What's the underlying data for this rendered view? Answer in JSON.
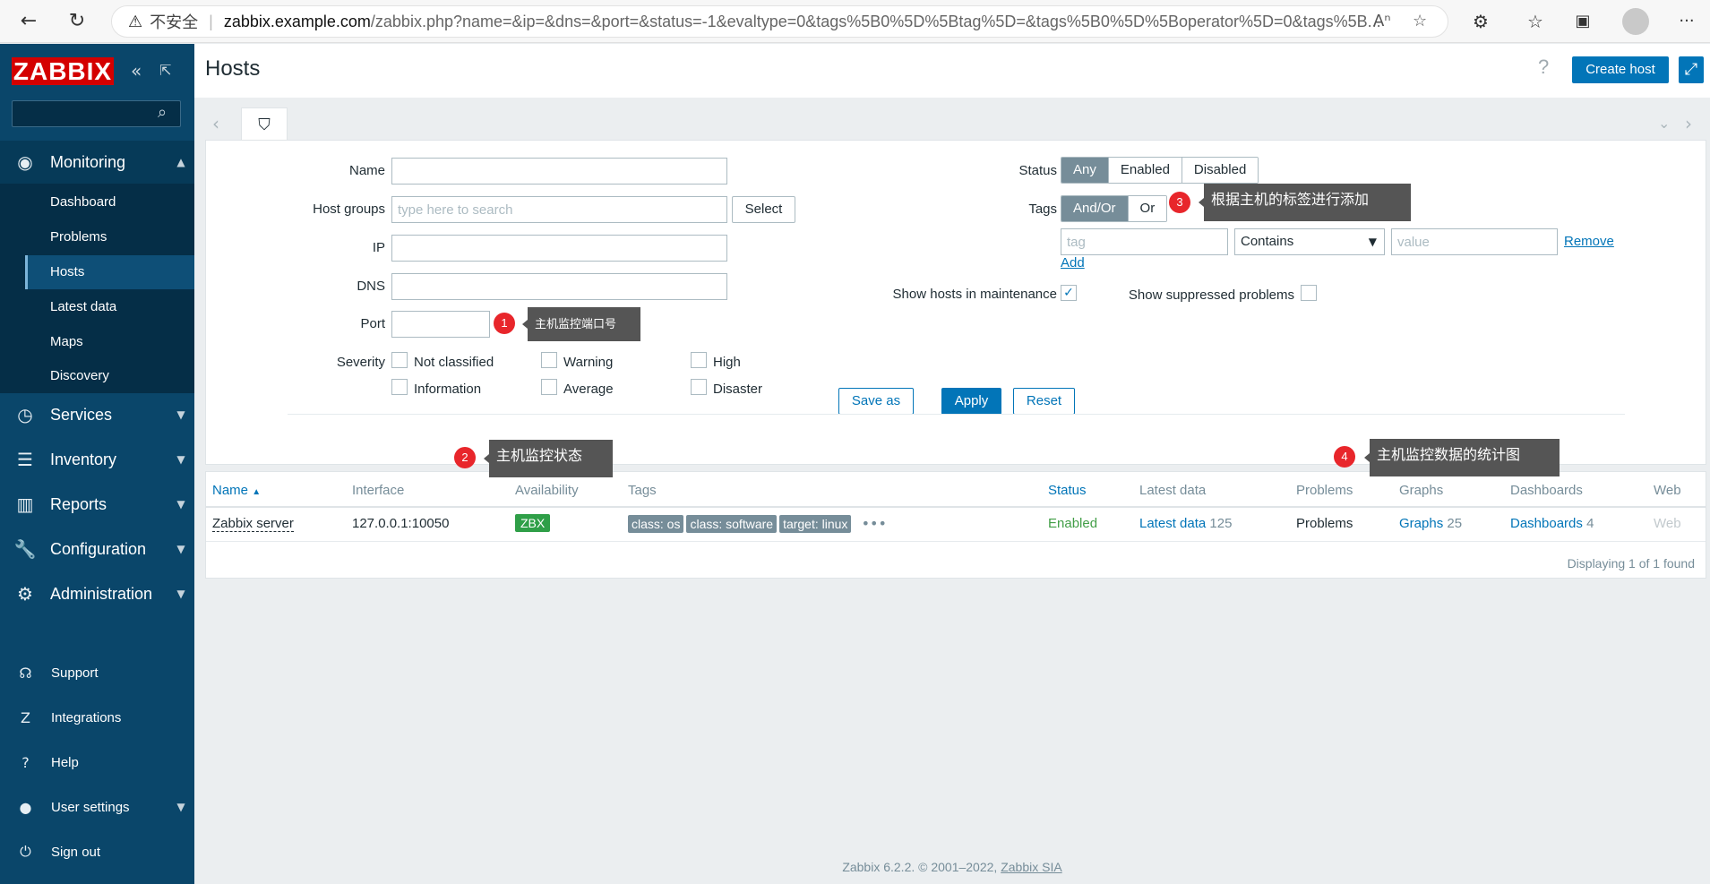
{
  "browser": {
    "insecure_label": "不安全",
    "url_host": "zabbix.example.com",
    "url_path": "/zabbix.php?name=&ip=&dns=&port=&status=-1&evaltype=0&tags%5B0%5D%5Btag%5D=&tags%5B0%5D%5Boperator%5D=0&tags%5B..."
  },
  "sidebar": {
    "logo": "ZABBIX",
    "search_placeholder": "",
    "menu": [
      {
        "label": "Monitoring",
        "icon": "eye-icon"
      },
      {
        "label": "Services",
        "icon": "stopwatch-icon"
      },
      {
        "label": "Inventory",
        "icon": "list-icon"
      },
      {
        "label": "Reports",
        "icon": "bar-chart-icon"
      },
      {
        "label": "Configuration",
        "icon": "wrench-icon"
      },
      {
        "label": "Administration",
        "icon": "cog-icon"
      }
    ],
    "monitoring_sub": [
      "Dashboard",
      "Problems",
      "Hosts",
      "Latest data",
      "Maps",
      "Discovery"
    ],
    "footer": [
      {
        "label": "Support",
        "icon": "headset-icon"
      },
      {
        "label": "Integrations",
        "icon": "integration-icon"
      },
      {
        "label": "Help",
        "icon": "question-icon"
      },
      {
        "label": "User settings",
        "icon": "user-icon"
      },
      {
        "label": "Sign out",
        "icon": "power-icon"
      }
    ]
  },
  "header": {
    "title": "Hosts",
    "help": "?",
    "create_host": "Create host"
  },
  "filter": {
    "name_label": "Name",
    "host_groups_label": "Host groups",
    "host_groups_placeholder": "type here to search",
    "select_button": "Select",
    "ip_label": "IP",
    "dns_label": "DNS",
    "port_label": "Port",
    "severity_label": "Severity",
    "severities": [
      "Not classified",
      "Warning",
      "High",
      "Information",
      "Average",
      "Disaster"
    ],
    "status_label": "Status",
    "status_options": [
      "Any",
      "Enabled",
      "Disabled"
    ],
    "status_selected": "Any",
    "tags_label": "Tags",
    "tags_options": [
      "And/Or",
      "Or"
    ],
    "tags_selected": "And/Or",
    "tag_placeholder": "tag",
    "operator": "Contains",
    "value_placeholder": "value",
    "remove": "Remove",
    "add": "Add",
    "show_maintenance_label": "Show hosts in maintenance",
    "show_maintenance_checked": true,
    "show_suppressed_label": "Show suppressed problems",
    "show_suppressed_checked": false,
    "save_as": "Save as",
    "apply": "Apply",
    "reset": "Reset"
  },
  "table": {
    "columns": [
      "Name",
      "Interface",
      "Availability",
      "Tags",
      "Status",
      "Latest data",
      "Problems",
      "Graphs",
      "Dashboards",
      "Web"
    ],
    "rows": [
      {
        "name": "Zabbix server",
        "interface": "127.0.0.1:10050",
        "availability": "ZBX",
        "tags": [
          "class: os",
          "class: software",
          "target: linux"
        ],
        "status": "Enabled",
        "latest_data": "Latest data",
        "latest_data_count": "125",
        "problems": "Problems",
        "graphs": "Graphs",
        "graphs_count": "25",
        "dashboards": "Dashboards",
        "dashboards_count": "4",
        "web": "Web"
      }
    ],
    "displaying": "Displaying 1 of 1 found"
  },
  "annotations": [
    {
      "num": "1",
      "text": "主机监控端口号"
    },
    {
      "num": "2",
      "text": "主机监控状态"
    },
    {
      "num": "3",
      "text": "根据主机的标签进行添加"
    },
    {
      "num": "4",
      "text": "主机监控数据的统计图"
    }
  ],
  "footer": {
    "text": "Zabbix 6.2.2. © 2001–2022,",
    "link": "Zabbix SIA"
  }
}
